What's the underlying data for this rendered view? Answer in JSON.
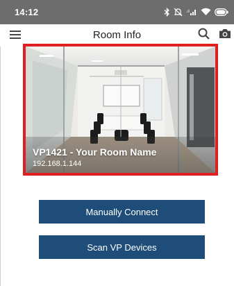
{
  "status_bar": {
    "time": "14:12",
    "icons": [
      "bluetooth-icon",
      "mute-icon",
      "signal-icon",
      "wifi-icon",
      "battery-icon"
    ],
    "background": "#6d6d6d"
  },
  "app_bar": {
    "title": "Room Info",
    "icons": [
      "menu-icon",
      "search-icon",
      "camera-icon"
    ]
  },
  "room": {
    "name": "VP1421 - Your Room Name",
    "ip": "192.168.1.144",
    "highlight_color": "#e02020"
  },
  "actions": {
    "manual_connect_label": "Manually Connect",
    "scan_label": "Scan VP Devices",
    "button_color": "#1f4d7a"
  }
}
